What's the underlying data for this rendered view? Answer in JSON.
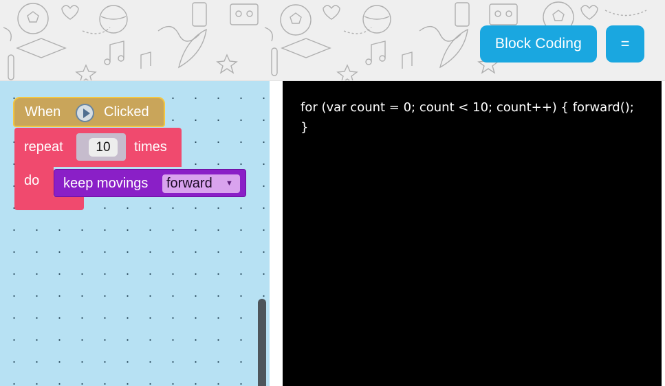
{
  "header": {
    "block_coding_label": "Block Coding",
    "menu_label": "="
  },
  "blocks": {
    "hat": {
      "when_label": "When",
      "clicked_label": "Clicked",
      "icon": "play-icon"
    },
    "repeat": {
      "repeat_label": "repeat",
      "count_value": "10",
      "times_label": "times",
      "do_label": "do"
    },
    "move": {
      "label": "keep movings",
      "direction": "forward"
    }
  },
  "code": {
    "line1": "for (var count = 0; count < 10; count++) { forward();",
    "line2": "}"
  },
  "colors": {
    "header_bg": "#efefef",
    "button_bg": "#1aa7e0",
    "workspace_bg": "#b7e1f3",
    "hat_block": "#c9a55a",
    "repeat_block": "#f04a6e",
    "move_block": "#8a1fc7",
    "code_bg": "#000000"
  }
}
